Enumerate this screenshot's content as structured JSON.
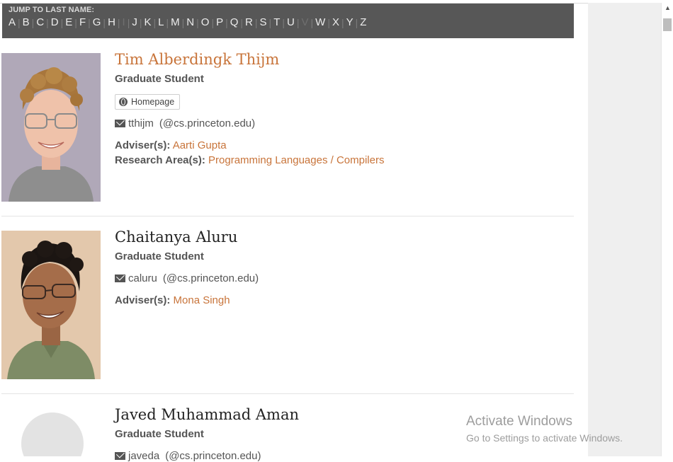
{
  "jump": {
    "label": "JUMP TO LAST NAME:",
    "letters": [
      {
        "l": "A",
        "on": true
      },
      {
        "l": "B",
        "on": true
      },
      {
        "l": "C",
        "on": true
      },
      {
        "l": "D",
        "on": true
      },
      {
        "l": "E",
        "on": true
      },
      {
        "l": "F",
        "on": true
      },
      {
        "l": "G",
        "on": true
      },
      {
        "l": "H",
        "on": true
      },
      {
        "l": "I",
        "on": false
      },
      {
        "l": "J",
        "on": true
      },
      {
        "l": "K",
        "on": true
      },
      {
        "l": "L",
        "on": true
      },
      {
        "l": "M",
        "on": true
      },
      {
        "l": "N",
        "on": true
      },
      {
        "l": "O",
        "on": true
      },
      {
        "l": "P",
        "on": true
      },
      {
        "l": "Q",
        "on": true
      },
      {
        "l": "R",
        "on": true
      },
      {
        "l": "S",
        "on": true
      },
      {
        "l": "T",
        "on": true
      },
      {
        "l": "U",
        "on": true
      },
      {
        "l": "V",
        "on": false
      },
      {
        "l": "W",
        "on": true
      },
      {
        "l": "X",
        "on": true
      },
      {
        "l": "Y",
        "on": true
      },
      {
        "l": "Z",
        "on": true
      }
    ]
  },
  "people": [
    {
      "name": "Tim Alberdingk Thijm",
      "role": "Graduate Student",
      "homepage_label": "Homepage",
      "email_user": "tthijm",
      "email_domain": "(@cs.princeton.edu)",
      "adviser_label": "Adviser(s):",
      "adviser": "Aarti Gupta",
      "research_label": "Research Area(s):",
      "research": "Programming Languages / Compilers"
    },
    {
      "name": "Chaitanya Aluru",
      "role": "Graduate Student",
      "email_user": "caluru",
      "email_domain": "(@cs.princeton.edu)",
      "adviser_label": "Adviser(s):",
      "adviser": "Mona Singh"
    },
    {
      "name": "Javed Muhammad Aman",
      "role": "Graduate Student",
      "email_user": "javeda",
      "email_domain": "(@cs.princeton.edu)"
    }
  ],
  "watermark": {
    "title": "Activate Windows",
    "subtitle": "Go to Settings to activate Windows."
  },
  "icons": {
    "homepage": "globe-icon",
    "email": "envelope-icon",
    "placeholder": "avatar-placeholder-icon"
  },
  "colors": {
    "accent": "#c8743a",
    "jumpbar_bg": "#575757",
    "text": "#555555"
  }
}
